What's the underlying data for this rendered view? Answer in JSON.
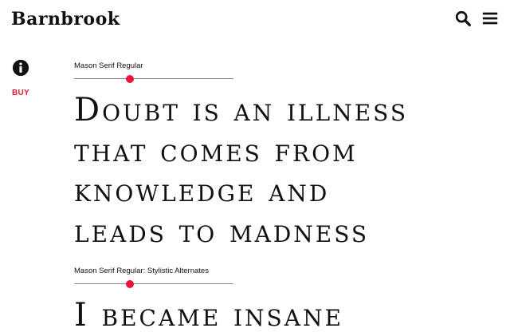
{
  "header": {
    "logo": "Barnbrook",
    "search_icon": "search-icon",
    "menu_icon": "hamburger-menu-icon"
  },
  "sidebar": {
    "info_icon": "info-icon",
    "buy_label": "BUY"
  },
  "specimens": [
    {
      "label": "Mason Serif Regular",
      "size_level": 0.35,
      "lines": [
        "Doubt is an illness",
        "that comes from",
        "knowledge and",
        "leads to madness"
      ]
    },
    {
      "label": "Mason Serif Regular: Stylistic Alternates",
      "size_level": 0.35,
      "lines": [
        "I became insane"
      ]
    }
  ],
  "colors": {
    "accent": "#e8173a",
    "text": "#111111",
    "background": "#ffffff"
  }
}
